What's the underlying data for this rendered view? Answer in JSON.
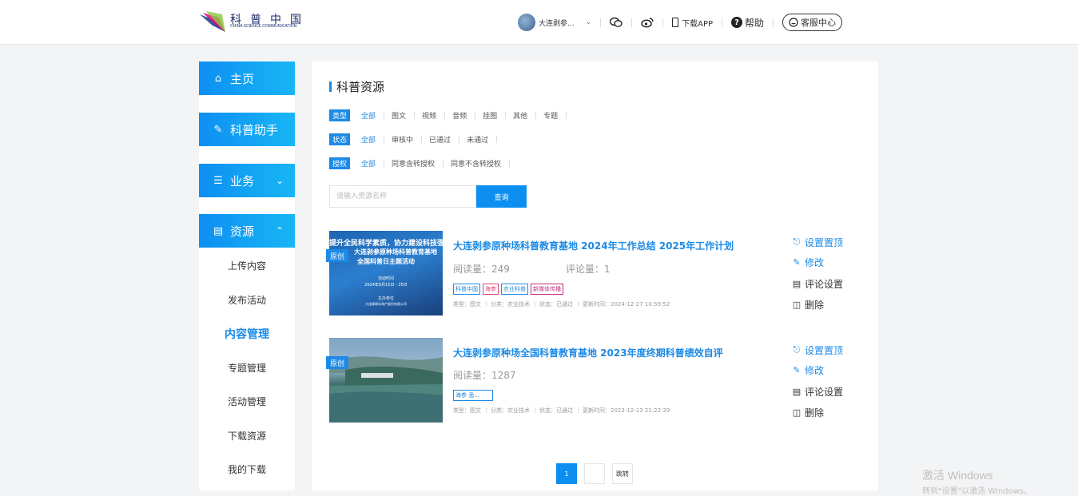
{
  "header": {
    "logo_cn": "科普中国",
    "logo_en": "CHINA SCIENCE COMMUNICATION",
    "user_name": "大连剥参...",
    "download_label": "下载APP",
    "help_label": "帮助",
    "service_label": "客服中心"
  },
  "sidebar": {
    "home": "主页",
    "assistant": "科普助手",
    "business": "业务",
    "resources": "资源",
    "items": [
      "上传内容",
      "发布活动",
      "内容管理",
      "专题管理",
      "活动管理",
      "下载资源",
      "我的下载"
    ]
  },
  "main": {
    "title": "科普资源",
    "filters": {
      "type": {
        "tag": "类型",
        "options": [
          "全部",
          "图文",
          "视频",
          "音频",
          "挂图",
          "其他",
          "专题"
        ]
      },
      "status": {
        "tag": "状态",
        "options": [
          "全部",
          "审核中",
          "已通过",
          "未通过"
        ]
      },
      "license": {
        "tag": "授权",
        "options": [
          "全部",
          "同意含转授权",
          "同意不含转授权"
        ]
      }
    },
    "search": {
      "placeholder": "请输入资源名称",
      "button": "查询"
    },
    "items": [
      {
        "badge": "原创",
        "thumb_lines": [
          "提升全民科学素质，协力建设科技强国",
          "大连剥参原种场科普教育基地",
          "全国科普日主题活动",
          "活动时间",
          "2024年9月15日 - 25日",
          "主办单位",
          "大连棒棰岛海产股份有限公司"
        ],
        "title": "大连剥参原种场科普教育基地 2024年工作总结 2025年工作计划",
        "reads": "阅读量：249",
        "comments": "评论量：1",
        "tags": [
          "科普中国",
          "海参",
          "农业科普",
          "新媒体传播"
        ],
        "meta": [
          "类型：图文",
          "分类：农业技术",
          "状态：已通过",
          "更新时间：2024-12-27 10:59:52"
        ],
        "actions": [
          "设置置顶",
          "修改",
          "评论设置",
          "删除"
        ]
      },
      {
        "badge": "原创",
        "title": "大连剥参原种场全国科普教育基地 2023年度终期科普绩效自评",
        "reads": "阅读量：1287",
        "tags": [
          "海参 渔..."
        ],
        "meta": [
          "类型：图文",
          "分类：农业技术",
          "状态：已通过",
          "更新时间：2023-12-13 21:22:39"
        ],
        "actions": [
          "设置置顶",
          "修改",
          "评论设置",
          "删除"
        ]
      }
    ],
    "pager": {
      "current": "1",
      "jump": "跳转"
    }
  },
  "watermark": {
    "line1": "激活 Windows",
    "line2": "转到\"设置\"以激活 Windows。"
  },
  "colors": {
    "accent": "#1c8ae6",
    "button_gradient_start": "#0d8ff2",
    "button_gradient_end": "#18b6f6"
  },
  "icons": {
    "home": "home-icon",
    "assistant": "pen-icon",
    "business": "layers-icon",
    "resources": "archive-icon",
    "wechat": "wechat-icon",
    "weibo": "weibo-icon"
  }
}
